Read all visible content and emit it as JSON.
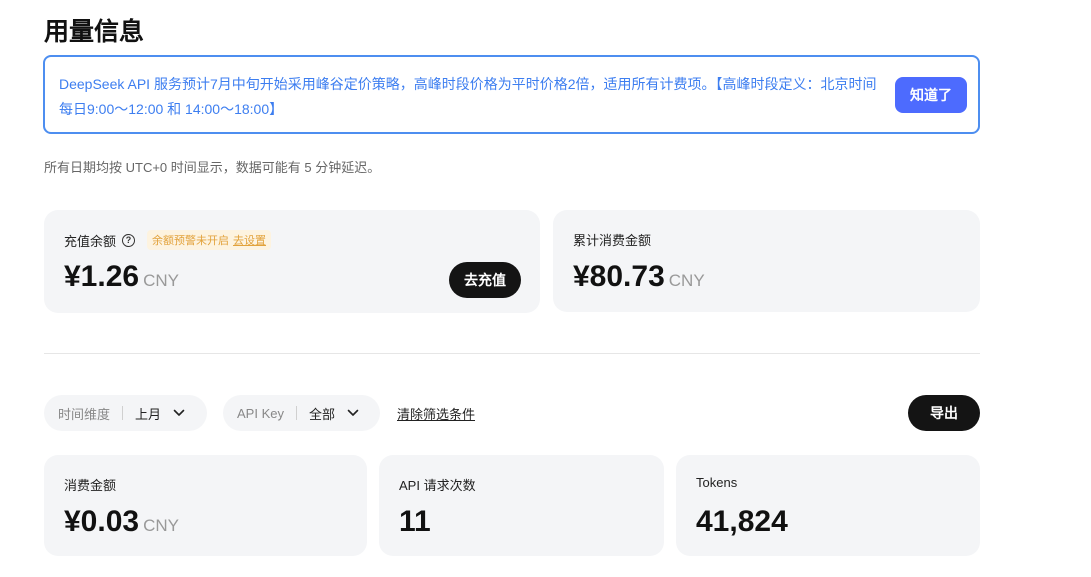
{
  "page": {
    "title": "用量信息"
  },
  "notice": {
    "text": "DeepSeek API 服务预计7月中旬开始采用峰谷定价策略，高峰时段价格为平时价格2倍，适用所有计费项。【高峰时段定义：北京时间每日9:00～12:00 和 14:00～18:00】",
    "button_label": "知道了"
  },
  "subnote": "所有日期均按 UTC+0 时间显示，数据可能有 5 分钟延迟。",
  "balance_card": {
    "label": "充值余额",
    "warning_text": "余额预警未开启",
    "warning_link": "去设置",
    "amount": "¥1.26",
    "unit": "CNY",
    "button_label": "去充值"
  },
  "total_card": {
    "label": "累计消费金额",
    "amount": "¥80.73",
    "unit": "CNY"
  },
  "filters": {
    "time": {
      "label": "时间维度",
      "value": "上月"
    },
    "api_key": {
      "label": "API Key",
      "value": "全部"
    },
    "clear_label": "清除筛选条件",
    "export_label": "导出"
  },
  "stats": {
    "cost": {
      "label": "消费金额",
      "value": "¥0.03",
      "unit": "CNY"
    },
    "requests": {
      "label": "API 请求次数",
      "value": "11"
    },
    "tokens": {
      "label": "Tokens",
      "value": "41,824"
    }
  },
  "colors": {
    "accent": "#4d6bfe",
    "notice_text": "#3d7ef0",
    "warning": "#e2a23b",
    "card_bg": "#f4f5f7"
  }
}
